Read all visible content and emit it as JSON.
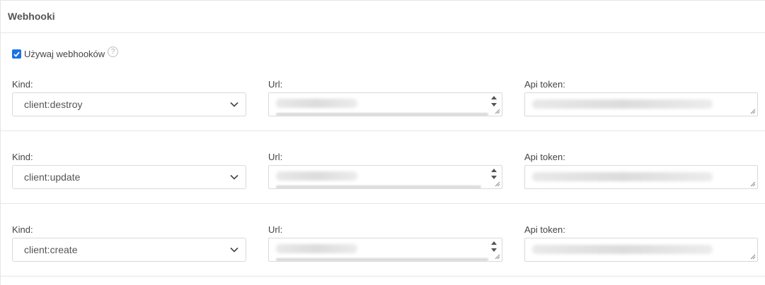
{
  "panel": {
    "title": "Webhooki"
  },
  "toggle": {
    "label": "Używaj webhooków",
    "checked": true,
    "help_icon_text": "?"
  },
  "labels": {
    "kind": "Kind:",
    "url": "Url:",
    "api_token": "Api token:"
  },
  "webhooks": [
    {
      "kind": "client:destroy"
    },
    {
      "kind": "client:update"
    },
    {
      "kind": "client:create"
    }
  ],
  "colors": {
    "checkbox_accent": "#1a73e8",
    "border": "#d9d9d9",
    "divider": "#e6e6e6"
  }
}
